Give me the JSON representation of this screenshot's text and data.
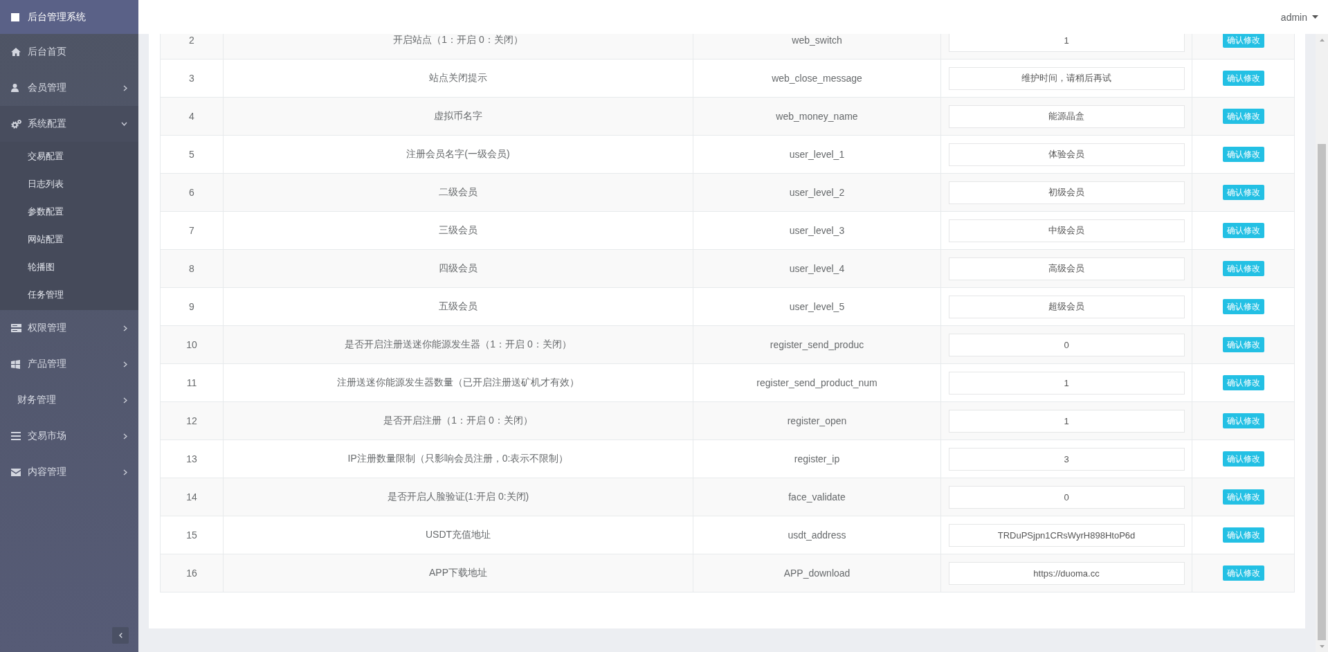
{
  "sidebar": {
    "title": "后台管理系统",
    "items": [
      {
        "kind": "link",
        "label": "后台首页"
      },
      {
        "kind": "menu",
        "label": "会员管理",
        "expanded": false
      },
      {
        "kind": "menu",
        "label": "系统配置",
        "expanded": true,
        "children": [
          {
            "label": "交易配置"
          },
          {
            "label": "日志列表"
          },
          {
            "label": "参数配置"
          },
          {
            "label": "网站配置"
          },
          {
            "label": "轮播图"
          },
          {
            "label": "任务管理"
          }
        ]
      },
      {
        "kind": "menu",
        "label": "权限管理",
        "expanded": false
      },
      {
        "kind": "menu",
        "label": "产品管理",
        "expanded": false
      },
      {
        "kind": "menu",
        "label": "财务管理",
        "expanded": false
      },
      {
        "kind": "menu",
        "label": "交易市场",
        "expanded": false
      },
      {
        "kind": "menu",
        "label": "内容管理",
        "expanded": false
      }
    ]
  },
  "header": {
    "user": "admin"
  },
  "table": {
    "rows": [
      {
        "cells": [
          "2",
          "开启站点（1：开启 0：关闭）",
          "web_switch"
        ],
        "value": "1",
        "button": "确认修改"
      },
      {
        "cells": [
          "3",
          "站点关闭提示",
          "web_close_message"
        ],
        "value": "维护时间，请稍后再试",
        "button": "确认修改"
      },
      {
        "cells": [
          "4",
          "虚拟币名字",
          "web_money_name"
        ],
        "value": "能源晶盒",
        "button": "确认修改"
      },
      {
        "cells": [
          "5",
          "注册会员名字(一级会员)",
          "user_level_1"
        ],
        "value": "体验会员",
        "button": "确认修改"
      },
      {
        "cells": [
          "6",
          "二级会员",
          "user_level_2"
        ],
        "value": "初级会员",
        "button": "确认修改"
      },
      {
        "cells": [
          "7",
          "三级会员",
          "user_level_3"
        ],
        "value": "中级会员",
        "button": "确认修改"
      },
      {
        "cells": [
          "8",
          "四级会员",
          "user_level_4"
        ],
        "value": "高级会员",
        "button": "确认修改"
      },
      {
        "cells": [
          "9",
          "五级会员",
          "user_level_5"
        ],
        "value": "超级会员",
        "button": "确认修改"
      },
      {
        "cells": [
          "10",
          "是否开启注册送迷你能源发生器（1：开启 0：关闭）",
          "register_send_produc"
        ],
        "value": "0",
        "button": "确认修改"
      },
      {
        "cells": [
          "11",
          "注册送迷你能源发生器数量（已开启注册送矿机才有效）",
          "register_send_product_num"
        ],
        "value": "1",
        "button": "确认修改"
      },
      {
        "cells": [
          "12",
          "是否开启注册（1：开启 0：关闭）",
          "register_open"
        ],
        "value": "1",
        "button": "确认修改"
      },
      {
        "cells": [
          "13",
          "IP注册数量限制（只影响会员注册，0:表示不限制）",
          "register_ip"
        ],
        "value": "3",
        "button": "确认修改"
      },
      {
        "cells": [
          "14",
          "是否开启人脸验证(1:开启 0:关闭)",
          "face_validate"
        ],
        "value": "0",
        "button": "确认修改"
      },
      {
        "cells": [
          "15",
          "USDT充值地址",
          "usdt_address"
        ],
        "value": "TRDuPSjpn1CRsWyrH898HtoP6d",
        "button": "确认修改"
      },
      {
        "cells": [
          "16",
          "APP下载地址",
          "APP_download"
        ],
        "value": "https://duoma.cc",
        "button": "确认修改"
      }
    ]
  }
}
